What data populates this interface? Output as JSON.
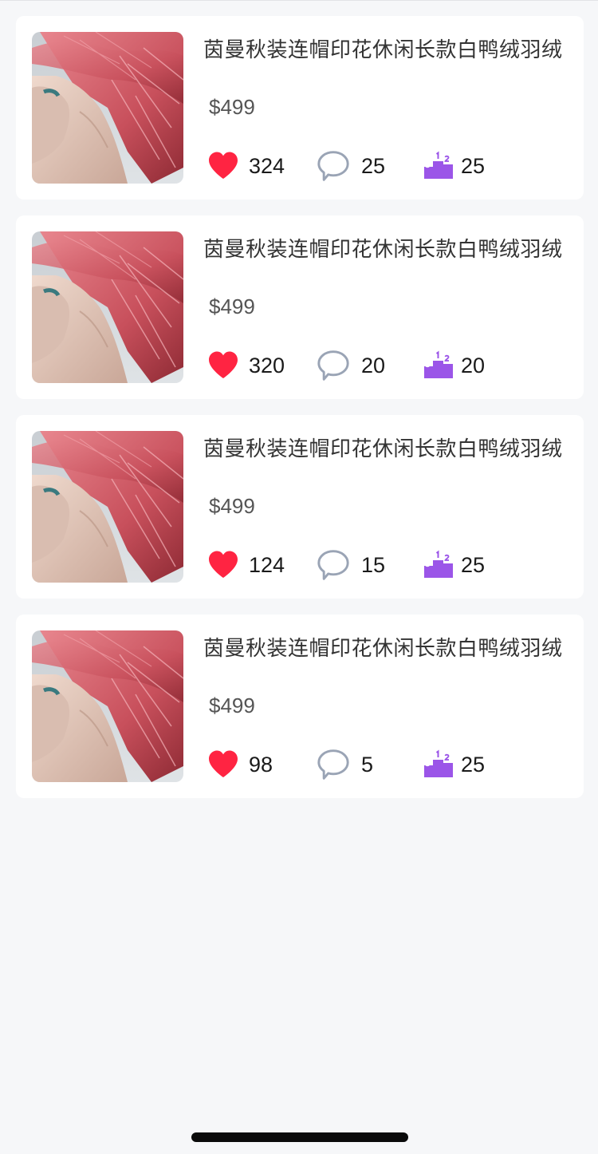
{
  "colors": {
    "background": "#f6f7f9",
    "card": "#ffffff",
    "like": "#ff2442",
    "comment": "#9aa4b5",
    "rank": "#9b55e8"
  },
  "icons": {
    "like": "heart-icon",
    "comment": "speech-bubble-icon",
    "rank": "podium-icon"
  },
  "products": [
    {
      "title": "茵曼秋装连帽印花休闲长款白鸭绒羽绒",
      "price": "$499",
      "likes": "324",
      "comments": "25",
      "rank": "25"
    },
    {
      "title": "茵曼秋装连帽印花休闲长款白鸭绒羽绒",
      "price": "$499",
      "likes": "320",
      "comments": "20",
      "rank": "20"
    },
    {
      "title": "茵曼秋装连帽印花休闲长款白鸭绒羽绒",
      "price": "$499",
      "likes": "124",
      "comments": "15",
      "rank": "25"
    },
    {
      "title": "茵曼秋装连帽印花休闲长款白鸭绒羽绒",
      "price": "$499",
      "likes": "98",
      "comments": "5",
      "rank": "25"
    }
  ]
}
